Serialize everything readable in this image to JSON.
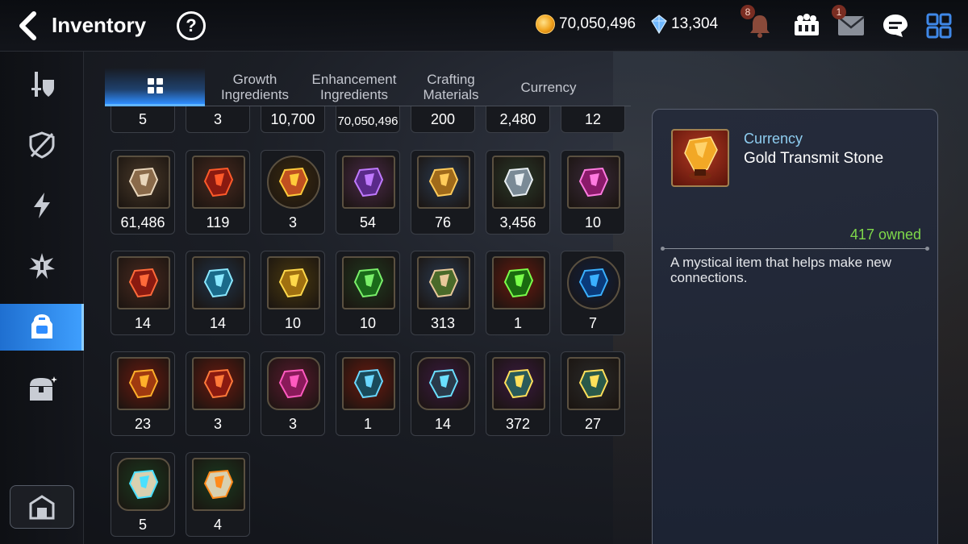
{
  "header": {
    "title": "Inventory",
    "help_label": "?",
    "gold": "70,050,496",
    "crystals": "13,304",
    "notification_badge": "8",
    "mail_badge": "1"
  },
  "tabs": [
    {
      "label": ""
    },
    {
      "label": "Growth\nIngredients"
    },
    {
      "label": "Enhancement\nIngredients"
    },
    {
      "label": "Crafting\nMaterials"
    },
    {
      "label": "Currency"
    }
  ],
  "sidebar": {
    "items": [
      {
        "icon": "equipment-icon"
      },
      {
        "icon": "shield-icon"
      },
      {
        "icon": "lightning-icon"
      },
      {
        "icon": "artifact-icon"
      },
      {
        "icon": "backpack-icon"
      },
      {
        "icon": "chest-icon"
      }
    ],
    "bottom_icon": "storage-icon"
  },
  "rows": [
    [
      {
        "count": "5"
      },
      {
        "count": "3"
      },
      {
        "count": "10,700"
      },
      {
        "count": "70,050,496"
      },
      {
        "count": "200"
      },
      {
        "count": "2,480"
      },
      {
        "count": "12"
      }
    ],
    [
      {
        "count": "61,486",
        "icon": "horse-figurine-icon",
        "bg": "#4a3a2a",
        "c1": "#e9d6bb",
        "c2": "#8a6a4a"
      },
      {
        "count": "119",
        "icon": "flame-leaf-icon",
        "bg": "#4a2a20",
        "c1": "#ff5a2a",
        "c2": "#8a1a10"
      },
      {
        "count": "3",
        "icon": "fox-mascot-icon",
        "bg": "#3a2a10",
        "c1": "#ffcb3a",
        "c2": "#c05020",
        "shape": "round"
      },
      {
        "count": "54",
        "icon": "purple-flower-icon",
        "bg": "#4a2a4a",
        "c1": "#c07aff",
        "c2": "#5a2a8a"
      },
      {
        "count": "76",
        "icon": "gold-flower-icon",
        "bg": "#2a3a50",
        "c1": "#ffcb5a",
        "c2": "#a06a1a"
      },
      {
        "count": "3,456",
        "icon": "silver-flower-icon",
        "bg": "#2a3a2a",
        "c1": "#e8eef2",
        "c2": "#7a8a96"
      },
      {
        "count": "10",
        "icon": "pink-rune-icon",
        "bg": "#3a2a3a",
        "c1": "#ff7ae0",
        "c2": "#8a1a6a"
      }
    ],
    [
      {
        "count": "14",
        "icon": "fire-rune-icon",
        "bg": "#4a2a20",
        "c1": "#ff6a3a",
        "c2": "#8a1a10"
      },
      {
        "count": "14",
        "icon": "ice-rune-icon",
        "bg": "#20344a",
        "c1": "#8ae8ff",
        "c2": "#1a6a8a"
      },
      {
        "count": "10",
        "icon": "light-rune-icon",
        "bg": "#4a3a10",
        "c1": "#ffd84a",
        "c2": "#a07010"
      },
      {
        "count": "10",
        "icon": "earth-rune-icon",
        "bg": "#203a20",
        "c1": "#7af06a",
        "c2": "#1a6a1a"
      },
      {
        "count": "313",
        "icon": "feather-plant-icon",
        "bg": "#2a3a50",
        "c1": "#e8c89a",
        "c2": "#4a6a2a"
      },
      {
        "count": "1",
        "icon": "green-orb-icon",
        "bg": "#6a1a10",
        "c1": "#7aff4a",
        "c2": "#1a6a10"
      },
      {
        "count": "7",
        "icon": "blue-sigil-icon",
        "bg": "#102040",
        "c1": "#3ab0ff",
        "c2": "#0a3a7a",
        "shape": "round"
      }
    ],
    [
      {
        "count": "23",
        "icon": "gold-transmit-stone-icon",
        "bg": "#6a1a10",
        "c1": "#ffb02a",
        "c2": "#a03a10"
      },
      {
        "count": "3",
        "icon": "red-transmit-stone-icon",
        "bg": "#6a1a10",
        "c1": "#ff7a3a",
        "c2": "#8a1a10"
      },
      {
        "count": "3",
        "icon": "potion-icon",
        "bg": "#5a1a30",
        "c1": "#ff5ac0",
        "c2": "#8a1a5a",
        "shape": "hex"
      },
      {
        "count": "1",
        "icon": "hammer-stone-icon",
        "bg": "#6a1a10",
        "c1": "#6ad8ff",
        "c2": "#1a4a5a"
      },
      {
        "count": "14",
        "icon": "blue-star-stone-icon",
        "bg": "#3a1a40",
        "c1": "#6ae0ff",
        "c2": "#2a3a4a",
        "shape": "hex"
      },
      {
        "count": "372",
        "icon": "cyan-transmit-stone-icon",
        "bg": "#3a1a40",
        "c1": "#ffe05a",
        "c2": "#2a5a5a"
      },
      {
        "count": "27",
        "icon": "teal-transmit-stone-icon",
        "bg": "#2a2a2a",
        "c1": "#ffe05a",
        "c2": "#2a5a4a"
      }
    ],
    [
      {
        "count": "5",
        "icon": "white-star-stone-icon",
        "bg": "#1a3a20",
        "c1": "#4ae0ff",
        "c2": "#d8d0b0",
        "shape": "hex"
      },
      {
        "count": "4",
        "icon": "white-transmit-stone-icon",
        "bg": "#1a3a20",
        "c1": "#ff8a1a",
        "c2": "#d8d0b0"
      }
    ]
  ],
  "detail": {
    "category": "Currency",
    "name": "Gold Transmit Stone",
    "owned": "417 owned",
    "description": "A mystical item that helps make new connections.",
    "icon": "gold-transmit-stone-icon"
  },
  "colors": {
    "accent_blue": "#3fa0ff",
    "owned_green": "#7ed84a",
    "category_blue": "#8ecdf0"
  }
}
